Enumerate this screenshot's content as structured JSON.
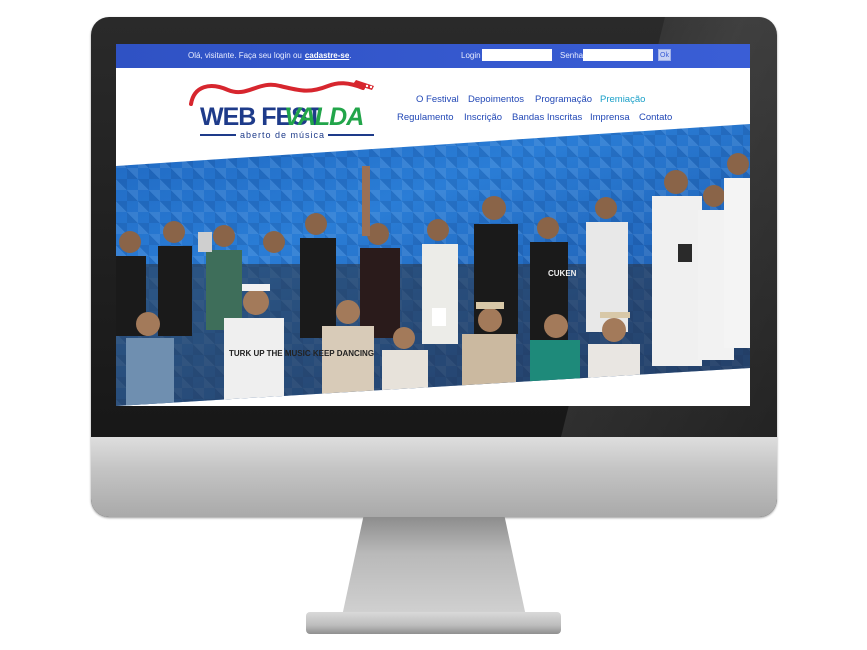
{
  "topbar": {
    "greeting": "Olá, visitante. Faça seu login ou",
    "register_link": "cadastre-se",
    "greeting_end": ".",
    "login_label": "Login",
    "password_label": "Senha",
    "ok_label": "Ok"
  },
  "logo": {
    "part1": "WEB FEST",
    "part2": "VALDA",
    "subtitle": "aberto de música"
  },
  "nav": {
    "row1": [
      "O Festival",
      "Depoimentos",
      "Programação",
      "Premiação"
    ],
    "row2": [
      "Regulamento",
      "Inscrição",
      "Bandas Inscritas",
      "Imprensa",
      "Contato"
    ]
  },
  "colors": {
    "topbar": "#3a5ed6",
    "nav_text": "#2248b6",
    "nav_active": "#1aa0c8",
    "logo_blue": "#1e3b8a",
    "logo_green": "#22a54a",
    "logo_red": "#d7262e"
  },
  "hero": {
    "shirt_text": "TURK UP THE MUSIC KEEP DANCING",
    "badge_text": "CUKEN"
  }
}
